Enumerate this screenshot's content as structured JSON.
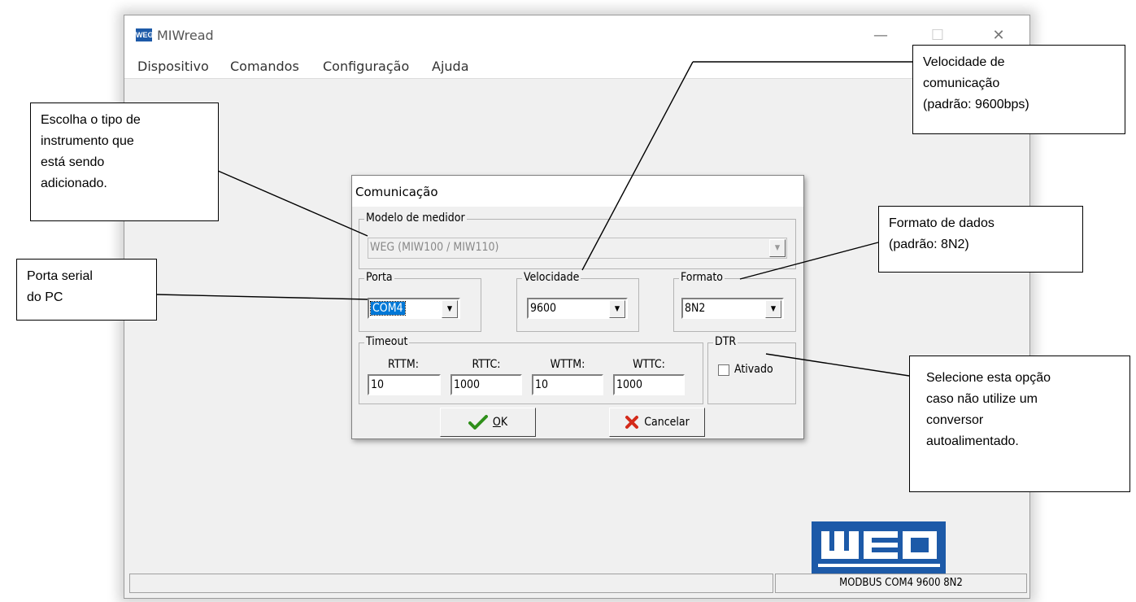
{
  "window": {
    "title": "MIWread",
    "logo_text": "WEG",
    "controls": {
      "minimize": "—",
      "maximize": "☐",
      "close": "✕"
    },
    "menu": [
      "Dispositivo",
      "Comandos",
      "Configuração",
      "Ajuda"
    ],
    "status_right": "MODBUS COM4 9600 8N2",
    "brand_color": "#1d5aa8"
  },
  "dialog": {
    "title": "Comunicação",
    "modelo": {
      "label": "Modelo de medidor",
      "value": "WEG (MIW100 / MIW110)"
    },
    "porta": {
      "label": "Porta",
      "value": "COM4"
    },
    "velocidade": {
      "label": "Velocidade",
      "value": "9600"
    },
    "formato": {
      "label": "Formato",
      "value": "8N2"
    },
    "timeout": {
      "label": "Timeout",
      "fields": [
        {
          "label": "RTTM:",
          "value": "10"
        },
        {
          "label": "RTTC:",
          "value": "1000"
        },
        {
          "label": "WTTM:",
          "value": "10"
        },
        {
          "label": "WTTC:",
          "value": "1000"
        }
      ]
    },
    "dtr": {
      "label": "DTR",
      "checkbox_label": "Ativado",
      "checked": false
    },
    "ok": {
      "accel": "O",
      "rest": "K"
    },
    "cancel": "Cancelar",
    "selection_color": "#0078d7"
  },
  "callouts": {
    "instrumento": [
      "Escolha o tipo de",
      "instrumento que",
      "está sendo",
      "adicionado."
    ],
    "porta": [
      "Porta serial",
      "do PC"
    ],
    "velocidade": [
      "Velocidade de",
      "comunicação",
      "(padrão: 9600bps)"
    ],
    "formato": [
      "Formato de dados",
      "(padrão: 8N2)"
    ],
    "dtr": [
      "Selecione esta opção",
      "caso não utilize um",
      "conversor",
      "autoalimentado."
    ]
  }
}
